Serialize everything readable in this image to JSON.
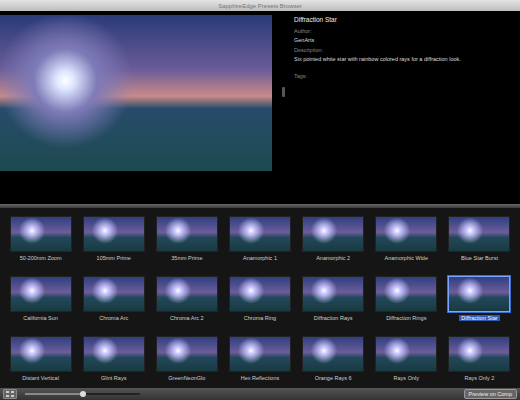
{
  "window": {
    "title": "SapphireEdge Presets Browser"
  },
  "preview": {
    "title": "Diffraction Star",
    "author_label": "Author:",
    "author": "GenArts",
    "description_label": "Description:",
    "description": "Six pointed white star with rainbow colored rays for a diffraction look.",
    "tags_label": "Tags:"
  },
  "presets": [
    {
      "label": "50-200mm Zoom",
      "selected": false
    },
    {
      "label": "105mm Prime",
      "selected": false
    },
    {
      "label": "35mm Prime",
      "selected": false
    },
    {
      "label": "Anamorphic 1",
      "selected": false
    },
    {
      "label": "Anamorphic 2",
      "selected": false
    },
    {
      "label": "Anamorphic Wide",
      "selected": false
    },
    {
      "label": "Blue Star Burst",
      "selected": false
    },
    {
      "label": "California Sun",
      "selected": false
    },
    {
      "label": "Chroma Arc",
      "selected": false
    },
    {
      "label": "Chroma Arc 2",
      "selected": false
    },
    {
      "label": "Chroma Ring",
      "selected": false
    },
    {
      "label": "Diffraction Rays",
      "selected": false
    },
    {
      "label": "Diffraction Rings",
      "selected": false
    },
    {
      "label": "Diffraction Star",
      "selected": true
    },
    {
      "label": "Distant Vertical",
      "selected": false
    },
    {
      "label": "Glint Rays",
      "selected": false
    },
    {
      "label": "GreenNeonGlo",
      "selected": false
    },
    {
      "label": "Hex Reflections",
      "selected": false
    },
    {
      "label": "Orange Rays 6",
      "selected": false
    },
    {
      "label": "Rays Only",
      "selected": false
    },
    {
      "label": "Rays Only 2",
      "selected": false
    }
  ],
  "bottom_bar": {
    "zoom_slider": {
      "level": 0.5
    },
    "preview_button": "Preview on Comp"
  }
}
